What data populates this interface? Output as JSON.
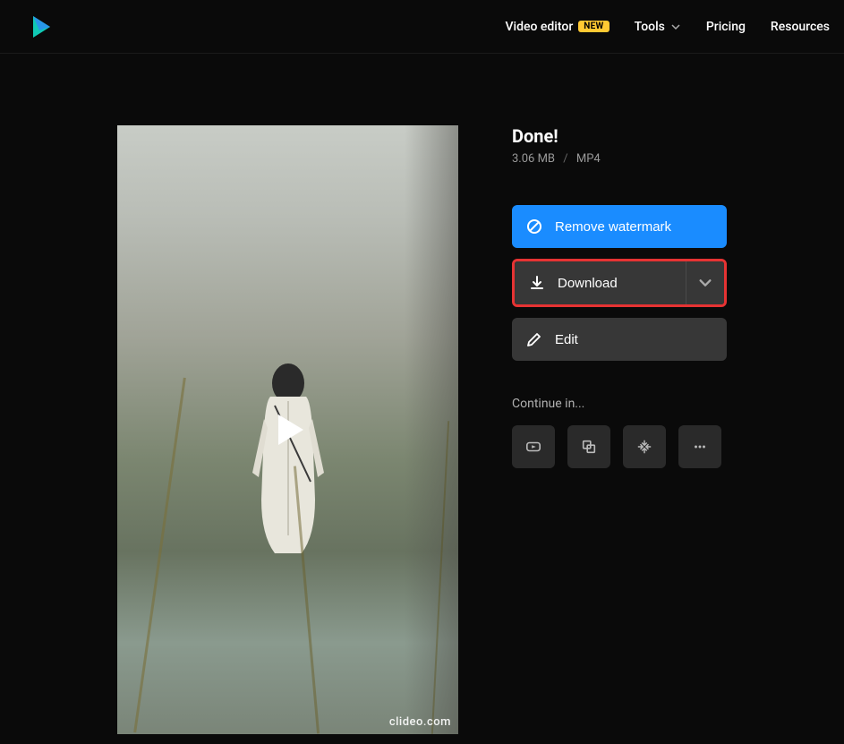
{
  "nav": {
    "video_editor": "Video editor",
    "new_badge": "NEW",
    "tools": "Tools",
    "pricing": "Pricing",
    "resources": "Resources"
  },
  "result": {
    "title": "Done!",
    "file_size": "3.06 MB",
    "file_format": "MP4"
  },
  "buttons": {
    "remove_watermark": "Remove watermark",
    "download": "Download",
    "edit": "Edit"
  },
  "continue": {
    "label": "Continue in..."
  },
  "preview": {
    "watermark": "clideo.com"
  }
}
